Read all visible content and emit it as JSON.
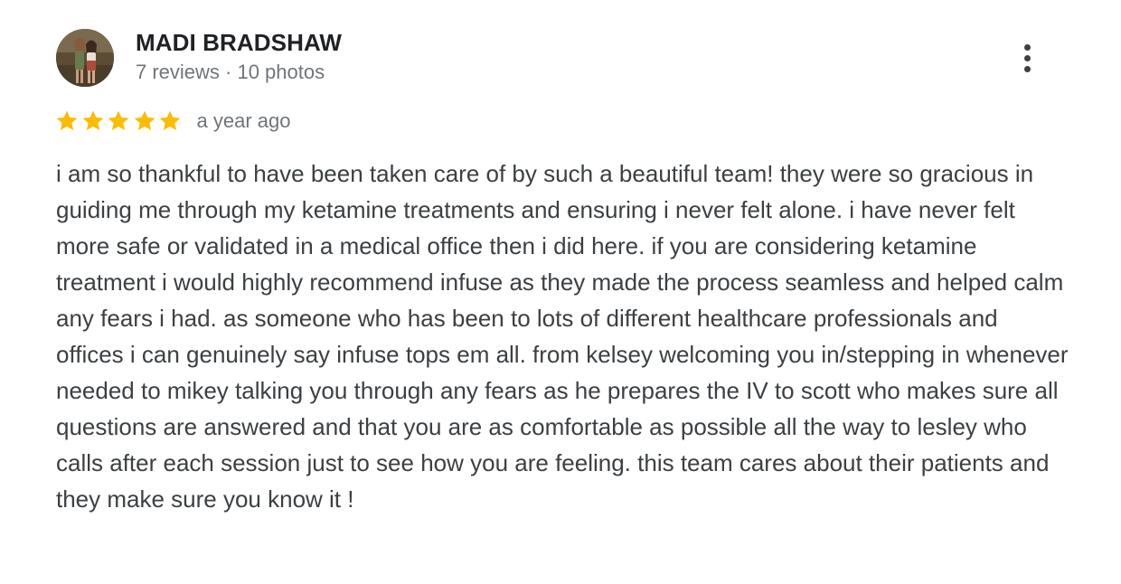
{
  "reviewer": {
    "name": "MADI BRADSHAW",
    "meta": "7 reviews · 10 photos",
    "avatar_icon": "reviewer-avatar-photo"
  },
  "menu": {
    "icon": "more-vertical-icon"
  },
  "rating": {
    "stars": 5,
    "max_stars": 5,
    "star_color": "#fbbc04",
    "date": "a year ago"
  },
  "review": {
    "text": "i am so thankful to have been taken care of by such a beautiful team! they were so gracious in guiding me through my ketamine treatments and ensuring i never felt alone. i have never felt more safe or validated in a medical office then i did here. if you are considering ketamine treatment i would highly recommend infuse as they made the process seamless and helped calm any fears i had. as someone who has been to lots of different healthcare professionals and offices i can genuinely say infuse tops em all. from kelsey welcoming you in/stepping in whenever needed to mikey talking you through any fears as he prepares the IV to scott who makes sure all questions are answered and that you are as comfortable as possible all the way to lesley who calls after each session just to see how you are feeling. this team cares about their patients and they make sure you know it !"
  }
}
